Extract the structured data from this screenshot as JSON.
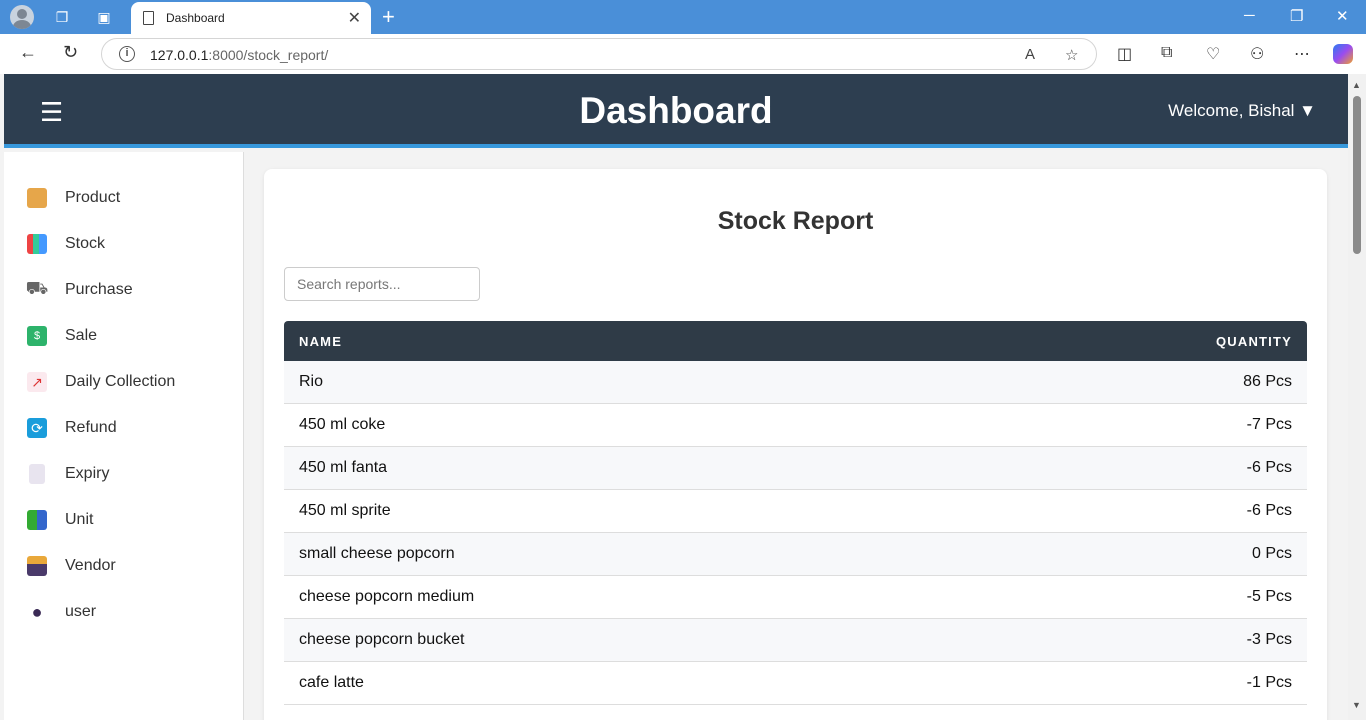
{
  "browser": {
    "tab_title": "Dashboard",
    "url_host": "127.0.0.1",
    "url_path": ":8000/stock_report/"
  },
  "header": {
    "title": "Dashboard",
    "welcome": "Welcome, Bishal ▼"
  },
  "sidebar": {
    "items": [
      {
        "label": "Product",
        "icon": "package-icon"
      },
      {
        "label": "Stock",
        "icon": "bar-chart-icon"
      },
      {
        "label": "Purchase",
        "icon": "shopping-cart-icon"
      },
      {
        "label": "Sale",
        "icon": "money-icon"
      },
      {
        "label": "Daily Collection",
        "icon": "line-chart-icon"
      },
      {
        "label": "Refund",
        "icon": "refresh-icon"
      },
      {
        "label": "Expiry",
        "icon": "receipt-icon"
      },
      {
        "label": "Unit",
        "icon": "books-icon"
      },
      {
        "label": "Vendor",
        "icon": "card-box-icon"
      },
      {
        "label": "user",
        "icon": "user-icon"
      }
    ]
  },
  "report": {
    "title": "Stock Report",
    "search_placeholder": "Search reports...",
    "columns": {
      "name": "NAME",
      "quantity": "QUANTITY"
    },
    "rows": [
      {
        "name": "Rio",
        "quantity": "86 Pcs"
      },
      {
        "name": "450 ml coke",
        "quantity": "-7 Pcs"
      },
      {
        "name": "450 ml fanta",
        "quantity": "-6 Pcs"
      },
      {
        "name": "450 ml sprite",
        "quantity": "-6 Pcs"
      },
      {
        "name": "small cheese popcorn",
        "quantity": "0 Pcs"
      },
      {
        "name": "cheese popcorn medium",
        "quantity": "-5 Pcs"
      },
      {
        "name": "cheese popcorn bucket",
        "quantity": "-3 Pcs"
      },
      {
        "name": "cafe latte",
        "quantity": "-1 Pcs"
      }
    ]
  },
  "colors": {
    "header_bg": "#2d3e50",
    "header_accent": "#3798dc",
    "table_head_bg": "#2f3b47"
  }
}
